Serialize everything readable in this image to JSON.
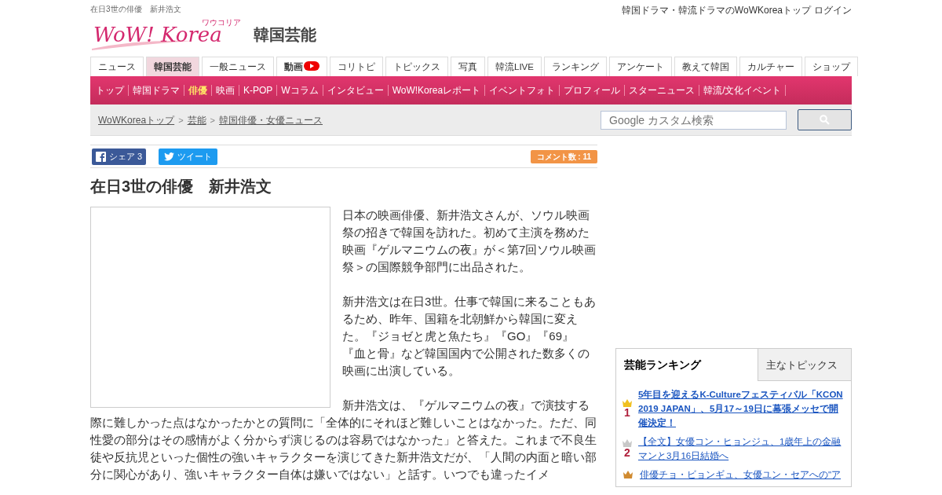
{
  "header": {
    "page_title": "在日3世の俳優　新井浩文",
    "top_link": "韓国ドラマ・韓流ドラマのWoWKoreaトップ",
    "login": "ログイン",
    "logo_text": "WoW! Korea",
    "logo_kana": "ワウコリア",
    "section": "韓国芸能"
  },
  "tabs": [
    {
      "label": "ニュース",
      "selected": false
    },
    {
      "label": "韓国芸能",
      "selected": true
    },
    {
      "label": "一般ニュース",
      "selected": false
    },
    {
      "label": "動画",
      "selected": false,
      "kind": "video"
    },
    {
      "label": "コリトピ",
      "selected": false
    },
    {
      "label": "トピックス",
      "selected": false
    },
    {
      "label": "写真",
      "selected": false
    },
    {
      "label": "韓流LIVE",
      "selected": false
    },
    {
      "label": "ランキング",
      "selected": false
    },
    {
      "label": "アンケート",
      "selected": false
    },
    {
      "label": "教えて韓国",
      "selected": false
    },
    {
      "label": "カルチャー",
      "selected": false
    },
    {
      "label": "ショップ",
      "selected": false
    }
  ],
  "subnav": [
    {
      "label": "トップ",
      "selected": false
    },
    {
      "label": "韓国ドラマ",
      "selected": false
    },
    {
      "label": "俳優",
      "selected": true
    },
    {
      "label": "映画",
      "selected": false
    },
    {
      "label": "K-POP",
      "selected": false
    },
    {
      "label": "Wコラム",
      "selected": false
    },
    {
      "label": "インタビュー",
      "selected": false
    },
    {
      "label": "WoW!Koreaレポート",
      "selected": false
    },
    {
      "label": "イベントフォト",
      "selected": false
    },
    {
      "label": "プロフィール",
      "selected": false
    },
    {
      "label": "スターニュース",
      "selected": false
    },
    {
      "label": "韓流/文化イベント",
      "selected": false
    }
  ],
  "breadcrumb": [
    {
      "label": "WoWKoreaトップ"
    },
    {
      "separator": ">",
      "label": "芸能"
    },
    {
      "separator": ">",
      "label": "韓国俳優・女優ニュース"
    }
  ],
  "search": {
    "placeholder": "Google カスタム検索"
  },
  "share": {
    "facebook": "シェア",
    "facebook_count": "3",
    "tweet": "ツイート",
    "comments": "コメント数 : 11"
  },
  "article": {
    "title": "在日3世の俳優　新井浩文",
    "paragraphs": [
      "日本の映画俳優、新井浩文さんが、ソウル映画祭の招きで韓国を訪れた。初めて主演を務めた映画『ゲルマニウムの夜』が＜第7回ソウル映画祭＞の国際競争部門に出品された。",
      "新井浩文は在日3世。仕事で韓国に来ることもあるため、昨年、国籍を北朝鮮から韓国に変えた。『ジョゼと虎と魚たち』『GO』『69』『血と骨』など韓国国内で公開された数多くの映画に出演している。",
      "新井浩文は、『ゲルマニウムの夜』で演技する際に難しかった点はなかったかとの質問に「全体的にそれほど難しいことはなかった。ただ、同性愛の部分はその感情がよく分からず演じるのは容易ではなかった」と答えた。これまで不良生徒や反抗児といった個性の強いキャラクターを演じてきた新井浩文だが、「人間の内面と暗い部分に関心があり、強いキャラクター自体は嫌いではない」と話す。いつでも違ったイメ"
    ]
  },
  "sidebar": {
    "tabs": [
      {
        "label": "芸能ランキング",
        "selected": true
      },
      {
        "label": "主なトピックス",
        "selected": false
      }
    ],
    "ranking": [
      {
        "rank": "1",
        "color": "#f0c020",
        "title": "5年目を迎えるK-Cultureフェスティバル「KCON 2019 JAPAN」、5月17～19日に幕張メッセで開催決定！",
        "bold": true
      },
      {
        "rank": "2",
        "color": "#c8c8c8",
        "title": "【全文】女優コン・ヒョンジュ、1歳年上の金融マンと3月16日結婚へ",
        "bold": false
      },
      {
        "color": "#d08a30",
        "title": "俳優チョ・ビョンギュ、女優ユン・セアへの\"ア",
        "bold": false
      }
    ]
  }
}
